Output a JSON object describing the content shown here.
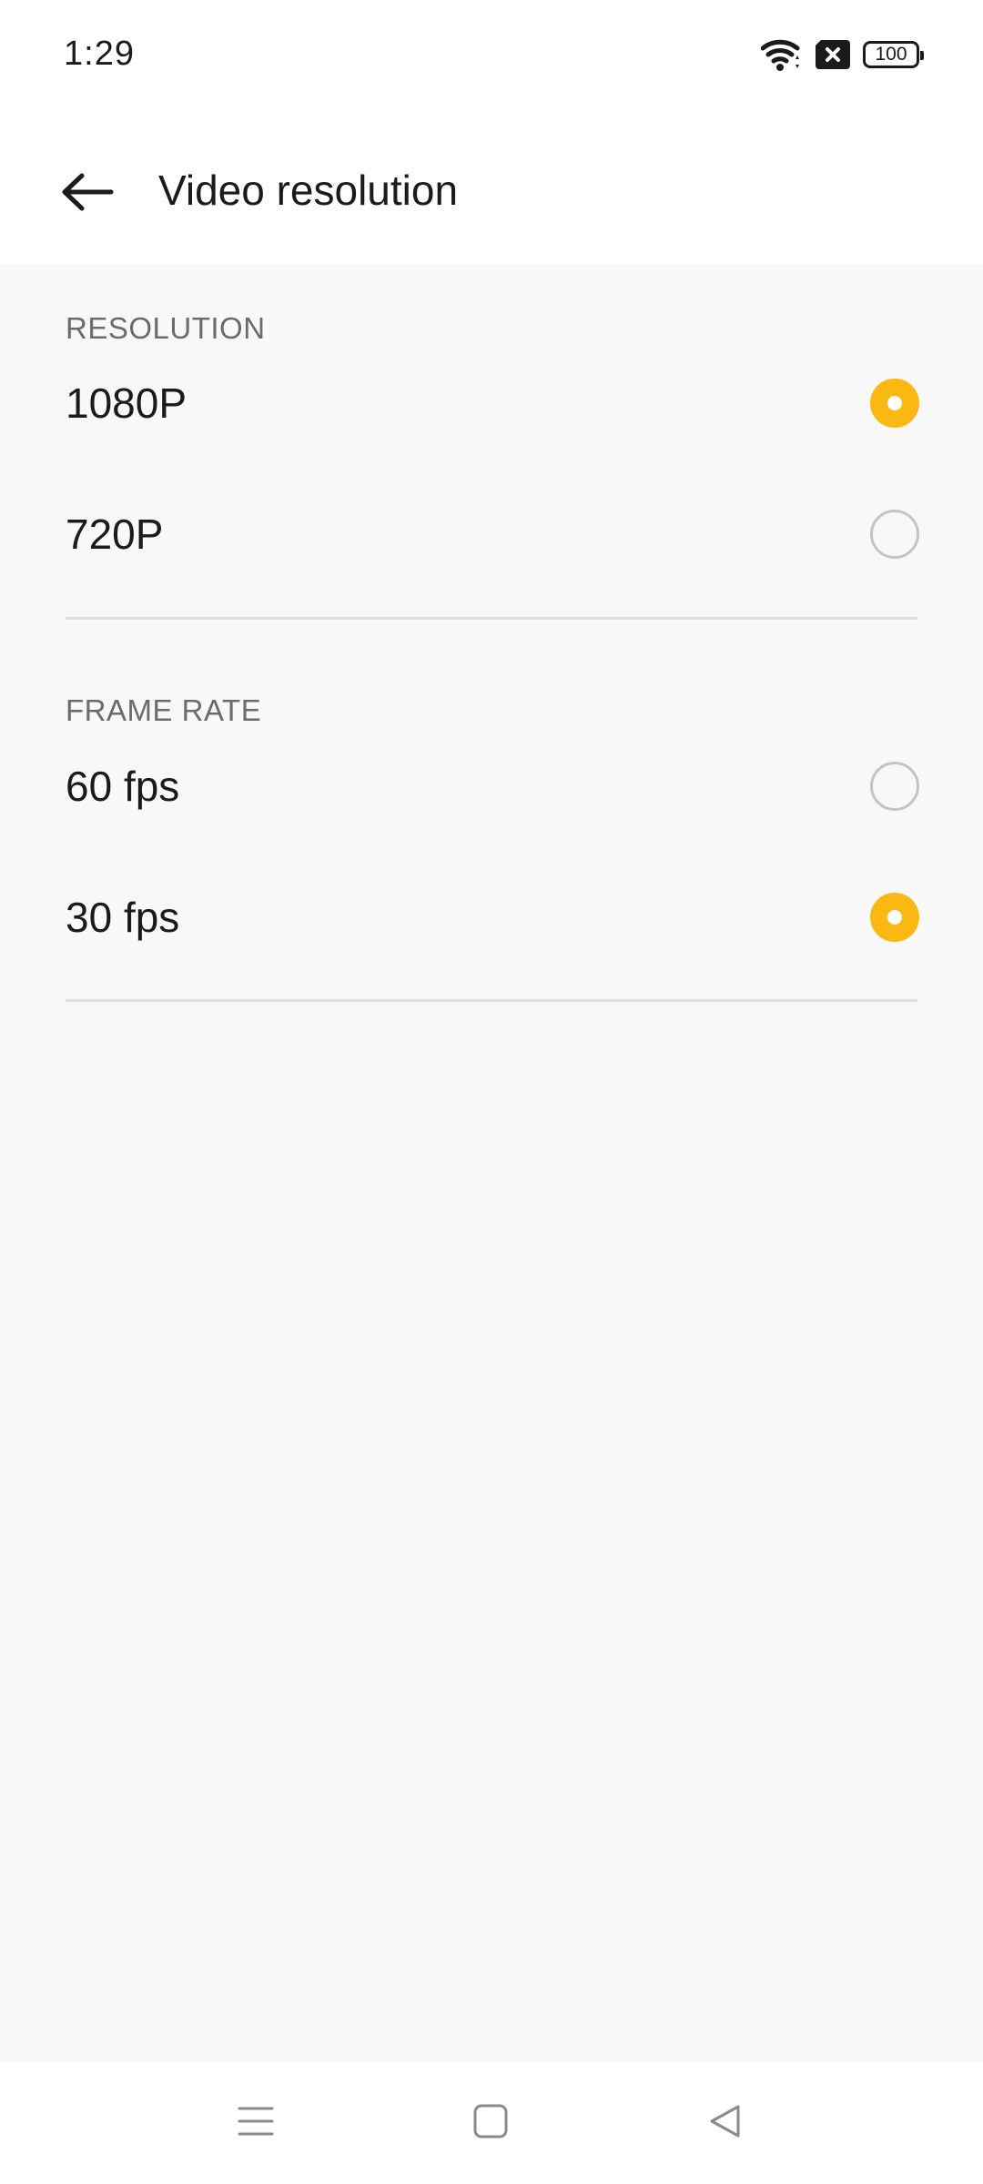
{
  "status_bar": {
    "time": "1:29",
    "battery": "100",
    "icons": [
      "wifi-icon",
      "sim-error-icon",
      "battery-icon"
    ]
  },
  "header": {
    "title": "Video resolution",
    "back_icon": "arrow-left-icon"
  },
  "sections": [
    {
      "header": "RESOLUTION",
      "options": [
        {
          "label": "1080P",
          "selected": true
        },
        {
          "label": "720P",
          "selected": false
        }
      ]
    },
    {
      "header": "FRAME RATE",
      "options": [
        {
          "label": "60 fps",
          "selected": false
        },
        {
          "label": "30 fps",
          "selected": true
        }
      ]
    }
  ],
  "nav_bar": {
    "icons": [
      "menu-icon",
      "home-icon",
      "back-icon"
    ]
  },
  "colors": {
    "accent": "#fbb812",
    "background": "#f8f8f8",
    "surface": "#ffffff"
  }
}
